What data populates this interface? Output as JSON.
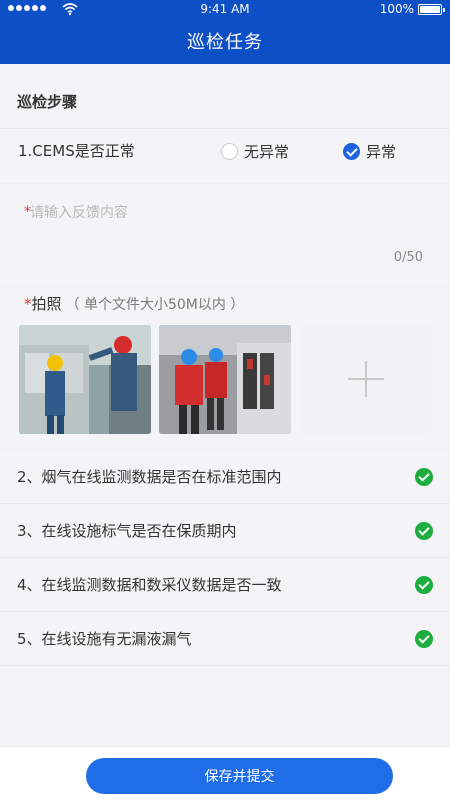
{
  "status_bar": {
    "time": "9:41 AM",
    "battery": "100%"
  },
  "header": {
    "title": "巡检任务"
  },
  "section": {
    "title": "巡检步骤"
  },
  "question1": {
    "label": "1.CEMS是否正常",
    "options": [
      {
        "label": "无异常",
        "selected": false
      },
      {
        "label": "异常",
        "selected": true
      }
    ]
  },
  "feedback": {
    "required_mark": "*",
    "placeholder": "请输入反馈内容",
    "counter": "0/50"
  },
  "photo": {
    "required_mark": "*",
    "label": "拍照",
    "hint": "（ 单个文件大小50M以内 ）"
  },
  "steps": [
    {
      "label": "2、烟气在线监测数据是否在标准范围内",
      "checked": true
    },
    {
      "label": "3、在线设施标气是否在保质期内",
      "checked": true
    },
    {
      "label": "4、在线监测数据和数采仪数据是否一致",
      "checked": true
    },
    {
      "label": "5、在线设施有无漏液漏气",
      "checked": true
    }
  ],
  "footer": {
    "submit_label": "保存并提交"
  },
  "colors": {
    "header_bg": "#0d4fc4",
    "primary": "#1f6ee8",
    "success": "#1cae3e",
    "required": "#e53935"
  }
}
